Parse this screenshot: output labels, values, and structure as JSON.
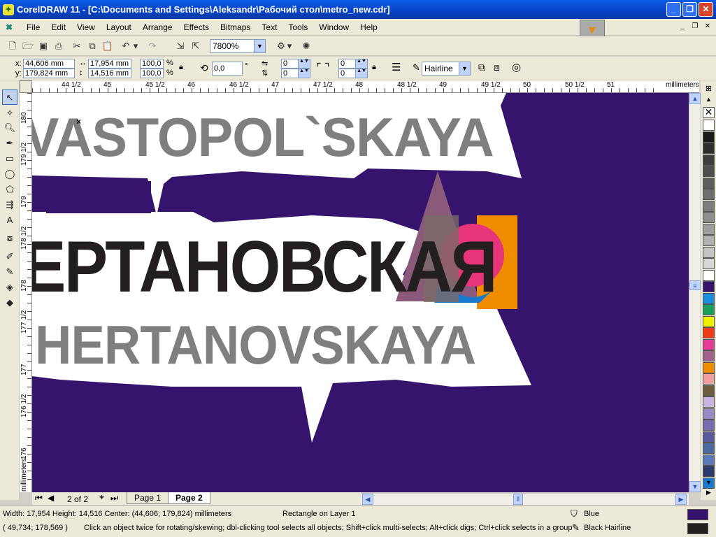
{
  "window": {
    "title": "CorelDRAW 11 - [C:\\Documents and Settings\\Aleksandr\\Рабочий стол\\metro_new.cdr]",
    "minimize": "_",
    "restore": "❐",
    "close": "✕"
  },
  "menu": [
    "File",
    "Edit",
    "View",
    "Layout",
    "Arrange",
    "Effects",
    "Bitmaps",
    "Text",
    "Tools",
    "Window",
    "Help"
  ],
  "toolbar": {
    "zoom": "7800%"
  },
  "propbar": {
    "x": "44,606 mm",
    "y": "179,824 mm",
    "width": "17,954 mm",
    "height": "14,516 mm",
    "scale_x": "100,0",
    "scale_y": "100,0",
    "pct": "%",
    "rotation": "0,0",
    "deg": "°",
    "corner1": "0",
    "corner2": "0",
    "corner3": "0",
    "corner4": "0",
    "outline": "Hairline",
    "xlabel": "x:",
    "ylabel": "y:"
  },
  "ruler": {
    "units": "millimeters",
    "h_labels": [
      {
        "t": "44 1/2"
      },
      {
        "t": "45"
      },
      {
        "t": "45 1/2"
      },
      {
        "t": "46"
      },
      {
        "t": "46 1/2"
      },
      {
        "t": "47"
      },
      {
        "t": "47 1/2"
      },
      {
        "t": "48"
      },
      {
        "t": "48 1/2"
      },
      {
        "t": "49"
      },
      {
        "t": "49 1/2"
      },
      {
        "t": "50"
      },
      {
        "t": "50 1/2"
      },
      {
        "t": "51"
      }
    ],
    "v_labels": [
      {
        "t": "180"
      },
      {
        "t": "179 1/2"
      },
      {
        "t": "179"
      },
      {
        "t": "178 1/2"
      },
      {
        "t": "178"
      },
      {
        "t": "177 1/2"
      },
      {
        "t": "177"
      },
      {
        "t": "176 1/2"
      },
      {
        "t": "176"
      }
    ]
  },
  "canvas": {
    "text_top": "VASTOPOL`SKAYA",
    "text_mid": "ЕРТАНОВСКАЯ",
    "text_bot": "HERTANOVSKAYA",
    "bg_color": "#36146e",
    "text_gray": "#7f7f7f",
    "text_black": "#231f1f"
  },
  "pages": {
    "count": "2 of 2",
    "tab1": "Page 1",
    "tab2": "Page 2"
  },
  "status": {
    "dims": "Width: 17,954  Height: 14,516  Center: (44,606; 179,824)  millimeters",
    "object": "Rectangle on Layer 1",
    "cursor": "( 49,734; 178,569 )",
    "hint": "Click an object twice for rotating/skewing; dbl-clicking tool selects all objects; Shift+click multi-selects; Alt+click digs; Ctrl+click selects in a group",
    "fill_name": "Blue",
    "outline_name": "Black  Hairline",
    "fill_color": "#36146e",
    "outline_color": "#231f1f"
  },
  "palette": [
    "#ffffff",
    "#1a1a1a",
    "#2e2e2e",
    "#3e3e3e",
    "#4e4e4e",
    "#5e5e5e",
    "#6e6e6e",
    "#7e7e7e",
    "#8e8e8e",
    "#9e9e9e",
    "#b0b0b0",
    "#c4c4c4",
    "#d8d8d8",
    "#ffffff",
    "#36146e",
    "#1a8fe0",
    "#1aa05a",
    "#f0f000",
    "#f03c14",
    "#e63c96",
    "#a0648c",
    "#f08c00",
    "#f0a0a0",
    "#6e5a3c",
    "#c8b4dc",
    "#9a8ac4",
    "#7a6ab0",
    "#5a5aa0",
    "#4a6aa0",
    "#5a7ab8",
    "#2a3a6a",
    "#1a7ad0"
  ]
}
